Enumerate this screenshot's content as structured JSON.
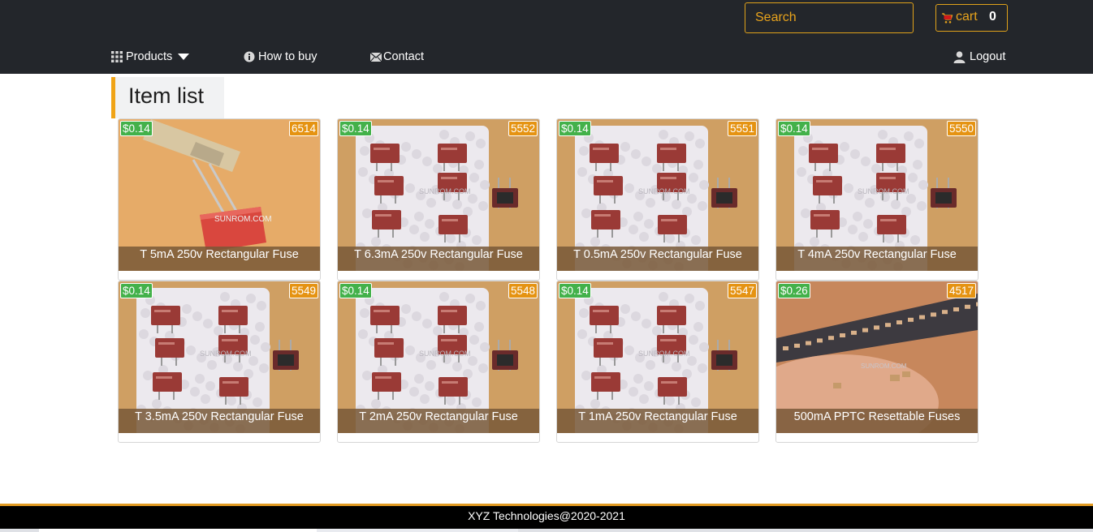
{
  "header": {
    "search_placeholder": "Search",
    "cart_label": "cart",
    "cart_count": "0"
  },
  "nav": {
    "products": "Products",
    "how_to_buy": "How to buy",
    "contact": "Contact",
    "logout": "Logout"
  },
  "page": {
    "title": "Item list"
  },
  "items": [
    {
      "price": "$0.14",
      "stock": "6514",
      "name": "T 5mA 250v Rectangular Fuse",
      "photo": "single-fuse"
    },
    {
      "price": "$0.14",
      "stock": "5552",
      "name": "T 6.3mA 250v Rectangular Fuse",
      "photo": "fuse-group"
    },
    {
      "price": "$0.14",
      "stock": "5551",
      "name": "T 0.5mA 250v Rectangular Fuse",
      "photo": "fuse-group"
    },
    {
      "price": "$0.14",
      "stock": "5550",
      "name": "T 4mA 250v Rectangular Fuse",
      "photo": "fuse-group"
    },
    {
      "price": "$0.14",
      "stock": "5549",
      "name": "T 3.5mA 250v Rectangular Fuse",
      "photo": "fuse-group"
    },
    {
      "price": "$0.14",
      "stock": "5548",
      "name": "T 2mA 250v Rectangular Fuse",
      "photo": "fuse-group"
    },
    {
      "price": "$0.14",
      "stock": "5547",
      "name": "T 1mA 250v Rectangular Fuse",
      "photo": "fuse-group"
    },
    {
      "price": "$0.26",
      "stock": "4517",
      "name": "500mA PPTC Resettable Fuses",
      "photo": "smd-fuses"
    }
  ],
  "photo_watermark": "SUNROM.COM",
  "footer": {
    "text": "XYZ Technologies@2020-2021"
  },
  "colors": {
    "accent": "#e8a31c",
    "price_badge": "#43b14a",
    "stock_badge": "#e59312",
    "header_bg": "#23262b"
  }
}
